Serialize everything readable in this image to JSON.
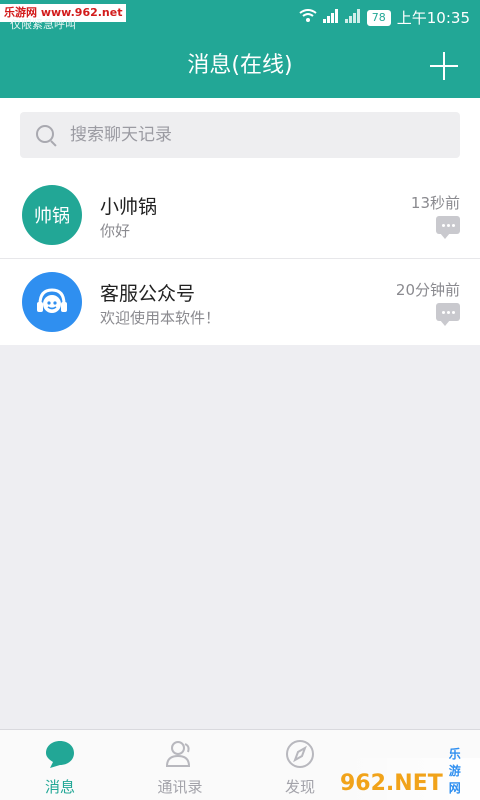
{
  "status": {
    "watermark": "乐游网 www.962.net",
    "carrier_text": "仅限紧急呼叫",
    "battery": "78",
    "time": "上午10:35"
  },
  "header": {
    "title": "消息(在线)"
  },
  "search": {
    "placeholder": "搜索聊天记录"
  },
  "conversations": [
    {
      "avatar_text": "帅锅",
      "name": "小帅锅",
      "preview": "你好",
      "time": "13秒前"
    },
    {
      "avatar_icon": "customer-service-icon",
      "name": "客服公众号",
      "preview": "欢迎使用本软件！",
      "time": "20分钟前"
    }
  ],
  "tabs": [
    {
      "label": "消息",
      "icon": "chat-bubble-icon",
      "active": true
    },
    {
      "label": "通讯录",
      "icon": "contacts-icon",
      "active": false
    },
    {
      "label": "发现",
      "icon": "compass-icon",
      "active": false
    }
  ],
  "bottom_watermark": {
    "brand": "962.NET",
    "sub": "乐游网"
  },
  "colors": {
    "accent": "#22a796",
    "service_avatar": "#2f8ff0"
  }
}
